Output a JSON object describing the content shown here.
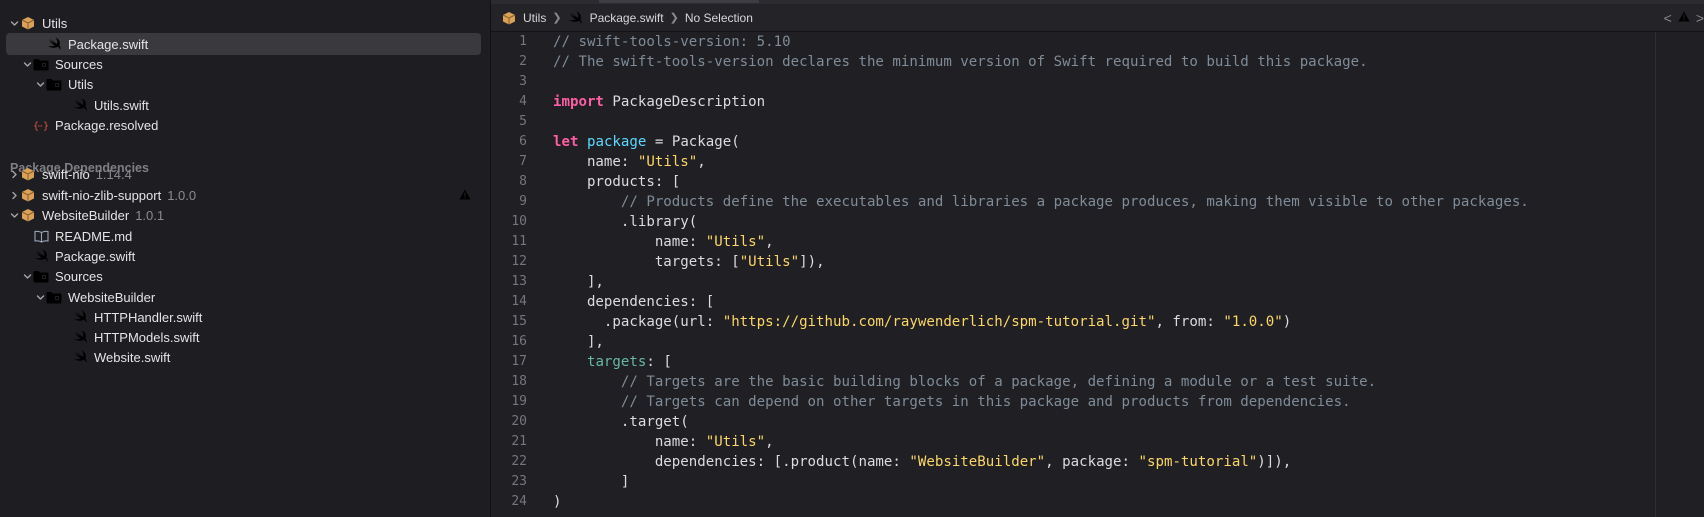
{
  "navigator": {
    "items": [
      {
        "label": "Utils",
        "version": "",
        "icon": "package-icon",
        "chevron": "down"
      },
      {
        "label": "Package.swift",
        "version": "",
        "icon": "swift-file-icon",
        "chevron": ""
      },
      {
        "label": "Sources",
        "version": "",
        "icon": "folder-icon",
        "chevron": "down"
      },
      {
        "label": "Utils",
        "version": "",
        "icon": "folder-icon",
        "chevron": "down"
      },
      {
        "label": "Utils.swift",
        "version": "",
        "icon": "swift-file-icon",
        "chevron": ""
      },
      {
        "label": "Package.resolved",
        "version": "",
        "icon": "json-file-icon",
        "chevron": ""
      }
    ],
    "dependencies_header": "Package Dependencies",
    "dependencies": [
      {
        "label": "swift-nio",
        "version": "1.14.4",
        "icon": "package-icon",
        "chevron": "right"
      },
      {
        "label": "swift-nio-zlib-support",
        "version": "1.0.0",
        "icon": "package-icon",
        "chevron": "right",
        "warning": true
      },
      {
        "label": "WebsiteBuilder",
        "version": "1.0.1",
        "icon": "package-icon",
        "chevron": "down"
      },
      {
        "label": "README.md",
        "version": "",
        "icon": "book-icon",
        "chevron": ""
      },
      {
        "label": "Package.swift",
        "version": "",
        "icon": "swift-file-icon",
        "chevron": ""
      },
      {
        "label": "Sources",
        "version": "",
        "icon": "folder-icon",
        "chevron": "down"
      },
      {
        "label": "WebsiteBuilder",
        "version": "",
        "icon": "folder-icon",
        "chevron": "down"
      },
      {
        "label": "HTTPHandler.swift",
        "version": "",
        "icon": "swift-file-icon",
        "chevron": ""
      },
      {
        "label": "HTTPModels.swift",
        "version": "",
        "icon": "swift-file-icon",
        "chevron": ""
      },
      {
        "label": "Website.swift",
        "version": "",
        "icon": "swift-file-icon",
        "chevron": ""
      }
    ]
  },
  "jumpbar": {
    "crumbs": [
      "Utils",
      "Package.swift",
      "No Selection"
    ]
  },
  "editor": {
    "lines": [
      [
        [
          "cm",
          "// swift-tools-version: 5.10"
        ]
      ],
      [
        [
          "cm",
          "// The swift-tools-version declares the minimum version of Swift required to build this package."
        ]
      ],
      [],
      [
        [
          "kw",
          "import"
        ],
        [
          "",
          " PackageDescription"
        ]
      ],
      [],
      [
        [
          "kw",
          "let"
        ],
        [
          "",
          " "
        ],
        [
          "id",
          "package"
        ],
        [
          "",
          " = Package("
        ]
      ],
      [
        [
          "",
          "    name: "
        ],
        [
          "st",
          "\"Utils\""
        ],
        [
          "",
          ","
        ]
      ],
      [
        [
          "",
          "    products: ["
        ]
      ],
      [
        [
          "cm",
          "        // Products define the executables and libraries a package produces, making them visible to other packages."
        ]
      ],
      [
        [
          "",
          "        .library("
        ]
      ],
      [
        [
          "",
          "            name: "
        ],
        [
          "st",
          "\"Utils\""
        ],
        [
          "",
          ","
        ]
      ],
      [
        [
          "",
          "            targets: ["
        ],
        [
          "st",
          "\"Utils\""
        ],
        [
          "",
          "]),"
        ]
      ],
      [
        [
          "",
          "    ],"
        ]
      ],
      [
        [
          "",
          "    dependencies: ["
        ]
      ],
      [
        [
          "",
          "      .package(url: "
        ],
        [
          "st",
          "\"https://github.com/raywenderlich/spm-tutorial.git\""
        ],
        [
          "",
          ", from: "
        ],
        [
          "st",
          "\"1.0.0\""
        ],
        [
          "",
          ")"
        ]
      ],
      [
        [
          "",
          "    ],"
        ]
      ],
      [
        [
          "",
          "    "
        ],
        [
          "tg",
          "targets"
        ],
        [
          "",
          ": ["
        ]
      ],
      [
        [
          "cm",
          "        // Targets are the basic building blocks of a package, defining a module or a test suite."
        ]
      ],
      [
        [
          "cm",
          "        // Targets can depend on other targets in this package and products from dependencies."
        ]
      ],
      [
        [
          "",
          "        .target("
        ]
      ],
      [
        [
          "",
          "            name: "
        ],
        [
          "st",
          "\"Utils\""
        ],
        [
          "",
          ","
        ]
      ],
      [
        [
          "",
          "            dependencies: [.product(name: "
        ],
        [
          "st",
          "\"WebsiteBuilder\""
        ],
        [
          "",
          ", package: "
        ],
        [
          "st",
          "\"spm-tutorial\""
        ],
        [
          "",
          ")]),"
        ]
      ],
      [
        [
          "",
          "        ]"
        ]
      ],
      [
        [
          "",
          ")"
        ]
      ]
    ]
  },
  "colors": {
    "comment": "#7f8c98",
    "keyword": "#fc5fa3",
    "string": "#fcd667",
    "identifier": "#5dd8ff",
    "warning": "#f5c518",
    "swift_orange": "#f0802c",
    "folder_blue": "#3a8ee6"
  }
}
